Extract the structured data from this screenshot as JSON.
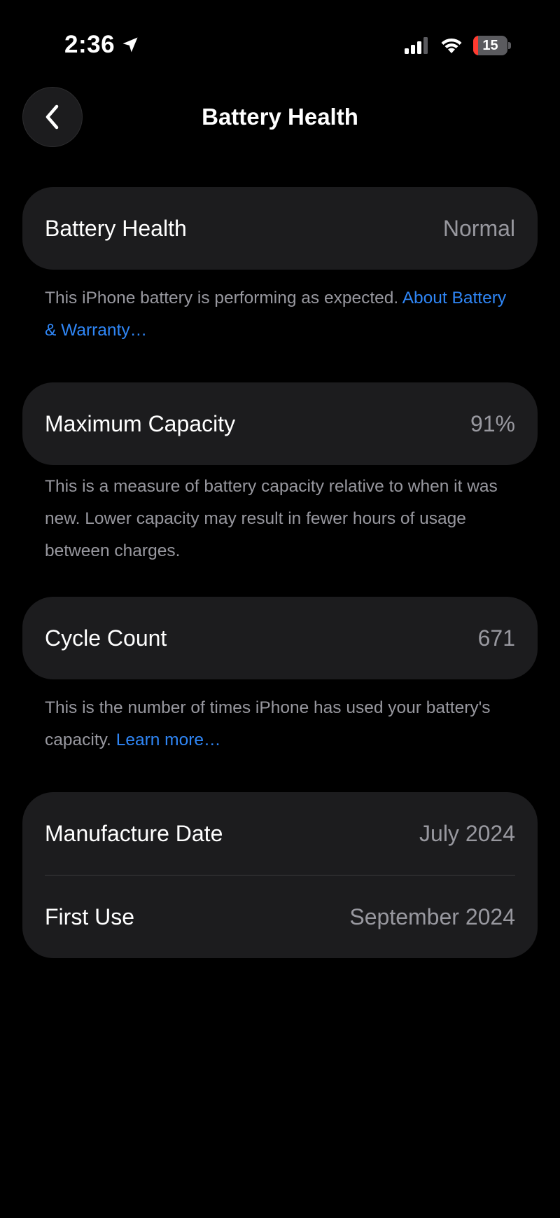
{
  "status_bar": {
    "time": "2:36",
    "location_icon": "location-arrow-icon",
    "signal_icon": "cellular-signal-icon",
    "wifi_icon": "wifi-icon",
    "battery_level": "15",
    "battery_fraction": 0.15,
    "battery_color": "#ff3b30"
  },
  "nav": {
    "back_icon": "chevron-left-icon",
    "title": "Battery Health"
  },
  "battery_health": {
    "label": "Battery Health",
    "value": "Normal",
    "note": "This iPhone battery is performing as expected.",
    "link": "About Battery & Warranty…"
  },
  "maximum_capacity": {
    "label": "Maximum Capacity",
    "value": "91%",
    "note": "This is a measure of battery capacity relative to when it was new. Lower capacity may result in fewer hours of usage between charges."
  },
  "cycle_count": {
    "label": "Cycle Count",
    "value": "671",
    "note": "This is the number of times iPhone has used your battery's capacity.",
    "link": "Learn more…"
  },
  "dates": {
    "manufacture_label": "Manufacture Date",
    "manufacture_value": "July 2024",
    "first_use_label": "First Use",
    "first_use_value": "September 2024"
  },
  "colors": {
    "background": "#000000",
    "card": "#1c1c1e",
    "secondary_text": "#98989f",
    "link": "#2f86f6"
  }
}
